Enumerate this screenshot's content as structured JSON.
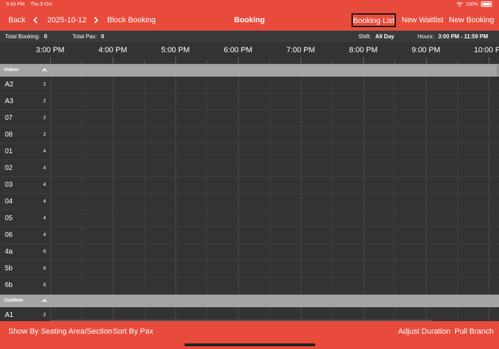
{
  "status_bar": {
    "time": "5:43 PM",
    "date": "Thu 9 Oct",
    "battery": "100%"
  },
  "nav": {
    "back": "Back",
    "date": "2025-10-12",
    "block_booking": "Block Booking",
    "title": "Booking",
    "booking_list": "Booking List",
    "new_waitlist": "New Waitlist",
    "new_booking": "New Booking"
  },
  "info": {
    "total_booking_label": "Total Booking:",
    "total_booking_value": "0",
    "total_pax_label": "Total Pax:",
    "total_pax_value": "0",
    "shift_label": "Shift:",
    "shift_value": "All Day",
    "hours_label": "Hours:",
    "hours_value": "3:00 PM - 11:59 PM"
  },
  "timeline": {
    "hours": [
      "3:00 PM",
      "4:00 PM",
      "5:00 PM",
      "6:00 PM",
      "7:00 PM",
      "8:00 PM",
      "9:00 PM",
      "10:00 PM"
    ]
  },
  "sections": [
    {
      "name": "Indoor",
      "tables": [
        {
          "name": "A2",
          "pax": "2"
        },
        {
          "name": "A3",
          "pax": "2"
        },
        {
          "name": "07",
          "pax": "2"
        },
        {
          "name": "08",
          "pax": "2"
        },
        {
          "name": "01",
          "pax": "4"
        },
        {
          "name": "02",
          "pax": "4"
        },
        {
          "name": "03",
          "pax": "4"
        },
        {
          "name": "04",
          "pax": "4"
        },
        {
          "name": "05",
          "pax": "4"
        },
        {
          "name": "06",
          "pax": "4"
        },
        {
          "name": "4a",
          "pax": "6"
        },
        {
          "name": "5b",
          "pax": "6"
        },
        {
          "name": "6b",
          "pax": "6"
        }
      ]
    },
    {
      "name": "Outdoor",
      "tables": [
        {
          "name": "A1",
          "pax": "2"
        }
      ]
    }
  ],
  "bottom": {
    "show_by": "Show By Seating Area/Section",
    "sort_by": "Sort By Pax",
    "adjust_duration": "Adjust Duration",
    "pull_branch": "Pull Branch"
  },
  "colors": {
    "accent": "#E84B3C",
    "grid_bg": "#333333",
    "section_bg": "#A4A4A4"
  }
}
